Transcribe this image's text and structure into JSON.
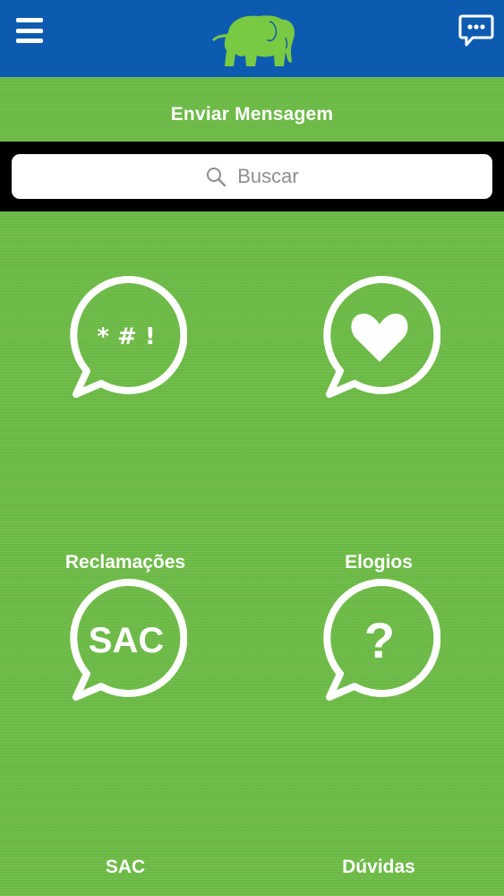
{
  "header": {
    "menu_icon": "hamburger-menu-icon",
    "logo": "elephant-logo",
    "chat_icon": "chat-bubble-icon"
  },
  "page": {
    "title": "Enviar Mensagem"
  },
  "search": {
    "placeholder": "Buscar",
    "icon": "search-icon"
  },
  "categories": [
    {
      "label": "Reclamações",
      "icon": "complaint-speech-bubble-icon",
      "glyph": "* # !"
    },
    {
      "label": "Elogios",
      "icon": "heart-speech-bubble-icon"
    },
    {
      "label": "SAC",
      "icon": "sac-speech-bubble-icon",
      "glyph": "SAC"
    },
    {
      "label": "Dúvidas",
      "icon": "question-speech-bubble-icon",
      "glyph": "?"
    }
  ],
  "colors": {
    "header": "#0d5bb0",
    "background": "#6cbb45",
    "logo": "#7ac943",
    "search_band": "#000000"
  }
}
